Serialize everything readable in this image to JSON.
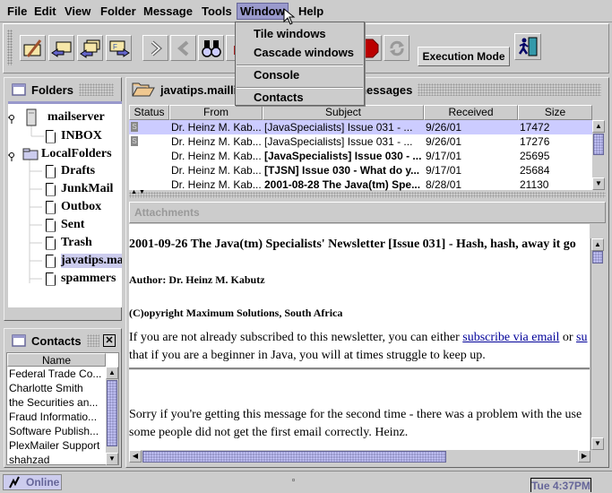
{
  "menubar": {
    "items": [
      "File",
      "Edit",
      "View",
      "Folder",
      "Message",
      "Tools",
      "Window",
      "Help"
    ],
    "active": "Window"
  },
  "window_menu": {
    "items": [
      "Tile windows",
      "Cascade windows",
      "Console",
      "Contacts"
    ]
  },
  "toolbar": {
    "buttons": [
      "compose-icon",
      "reply-icon",
      "reply-all-icon",
      "forward-icon",
      "next-icon",
      "previous-icon",
      "search-icon",
      "user-icon",
      "stop-icon",
      "refresh-icon"
    ],
    "execution_mode_label": "Execution Mode",
    "exit_icon": "exit-icon"
  },
  "folders": {
    "title": "Folders",
    "tree": [
      {
        "label": "mailserver",
        "level": 0,
        "type": "server"
      },
      {
        "label": "INBOX",
        "level": 1,
        "type": "file"
      },
      {
        "label": "LocalFolders",
        "level": 0,
        "type": "folder"
      },
      {
        "label": "Drafts",
        "level": 1,
        "type": "file"
      },
      {
        "label": "JunkMail",
        "level": 1,
        "type": "file"
      },
      {
        "label": "Outbox",
        "level": 1,
        "type": "file"
      },
      {
        "label": "Sent",
        "level": 1,
        "type": "file"
      },
      {
        "label": "Trash",
        "level": 1,
        "type": "file"
      },
      {
        "label": "javatips.ma",
        "level": 1,
        "type": "file",
        "selected": true
      },
      {
        "label": "spammers",
        "level": 1,
        "type": "file"
      }
    ]
  },
  "contacts": {
    "title": "Contacts",
    "column": "Name",
    "items": [
      "Federal Trade Co...",
      "Charlotte Smith",
      "the Securities an...",
      "Fraud Informatio...",
      "Software Publish...",
      "PlexMailer Support",
      "shahzad"
    ]
  },
  "message_list": {
    "title_left": "javatips.maillis",
    "title_right": "messages",
    "columns": [
      "Status",
      "From",
      "Subject",
      "Received",
      "Size"
    ],
    "rows": [
      {
        "status": "S",
        "from": "Dr. Heinz M. Kab...",
        "subject": "[JavaSpecialists] Issue 031 - ...",
        "received": "9/26/01",
        "size": "17472",
        "bold": false,
        "selected": true
      },
      {
        "status": "S",
        "from": "Dr. Heinz M. Kab...",
        "subject": "[JavaSpecialists] Issue 031 - ...",
        "received": "9/26/01",
        "size": "17276",
        "bold": false,
        "selected": false
      },
      {
        "status": "",
        "from": "Dr. Heinz M. Kab...",
        "subject": "[JavaSpecialists] Issue 030 - ...",
        "received": "9/17/01",
        "size": "25695",
        "bold": true,
        "selected": false
      },
      {
        "status": "",
        "from": "Dr. Heinz M. Kab...",
        "subject": "[TJSN] Issue 030 - What do y...",
        "received": "9/17/01",
        "size": "25684",
        "bold": true,
        "selected": false
      },
      {
        "status": "",
        "from": "Dr. Heinz M. Kab...",
        "subject": "2001-08-28 The Java(tm) Spe...",
        "received": "8/28/01",
        "size": "21130",
        "bold": true,
        "selected": false
      }
    ]
  },
  "attachments": {
    "label": "Attachments"
  },
  "message_body": {
    "title": "2001-09-26 The Java(tm) Specialists' Newsletter [Issue 031] - Hash, hash, away it go",
    "author": "Author: Dr. Heinz M. Kabutz",
    "copyright": "(C)opyright Maximum Solutions, South Africa",
    "para1_a": "If you are not already subscribed to this newsletter, you can either ",
    "para1_link1": "subscribe via email",
    "para1_b": " or ",
    "para1_link2": "su",
    "para1_line2": "that if you are a beginner in Java, you will at times struggle to keep up.",
    "para2_line1": "Sorry if you're getting this message for the second time - there was a problem with the use",
    "para2_line2": "some people did not get the first email correctly. Heinz."
  },
  "statusbar": {
    "online_label": "Online",
    "clock": "Tue 4:37PM"
  }
}
